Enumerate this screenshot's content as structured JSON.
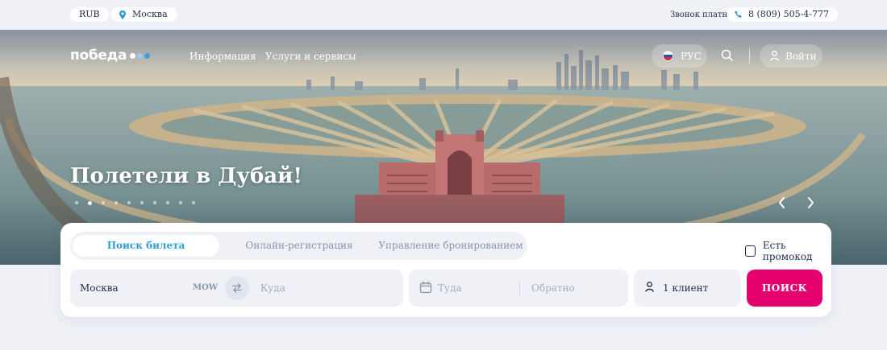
{
  "topbar": {
    "currency": "RUB",
    "city": "Москва",
    "paid_call_label": "Звонок платный",
    "phone": "8 (809) 505-4-777"
  },
  "header": {
    "logo_text": "победа",
    "logo_dot_colors": [
      "#ffffff",
      "#9ccbef",
      "#3fa0e0"
    ],
    "nav": [
      {
        "label": "Информация"
      },
      {
        "label": "Услуги и сервисы"
      }
    ],
    "language": "РУС",
    "login_label": "Войти"
  },
  "hero": {
    "headline": "Полетели в Дубай!",
    "slide_count": 10,
    "active_slide": 2
  },
  "booking": {
    "tabs": [
      {
        "label": "Поиск билета",
        "active": true
      },
      {
        "label": "Онлайн-регистрация",
        "active": false
      },
      {
        "label": "Управление бронированием",
        "active": false
      }
    ],
    "promo_label": "Есть промокод",
    "from_value": "Москва",
    "from_code": "MOW",
    "to_placeholder": "Куда",
    "depart_placeholder": "Туда",
    "return_placeholder": "Обратно",
    "passengers": "1 клиент",
    "search_label": "ПОИСК"
  },
  "colors": {
    "accent_pink": "#e5006d",
    "accent_blue": "#2f9bd6",
    "text_dark": "#1d2b4f",
    "page_bg": "#eff1f6"
  },
  "icons": [
    "map-pin-icon",
    "phone-icon",
    "russia-flag-icon",
    "search-icon",
    "user-icon",
    "chevron-left-icon",
    "chevron-right-icon",
    "swap-icon",
    "calendar-icon",
    "passenger-icon",
    "checkbox-icon"
  ]
}
